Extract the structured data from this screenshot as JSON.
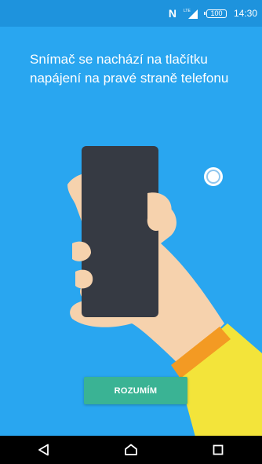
{
  "status_bar": {
    "nfc_label": "N",
    "network_label": "LTE",
    "battery_level": "100",
    "time": "14:30"
  },
  "instruction": {
    "text": "Snímač se nachází na tlačítku napájení na pravé straně telefonu"
  },
  "actions": {
    "understand_label": "ROZUMÍM"
  },
  "nav_bar": {
    "back_icon": "back-triangle-icon",
    "home_icon": "home-icon",
    "recents_icon": "recents-square-icon"
  },
  "colors": {
    "background": "#29a6f0",
    "status_bar": "#1e93dd",
    "button": "#3ab394",
    "phone_body": "#363a43",
    "skin": "#f6d2ad",
    "sleeve": "#f3e43a",
    "watch_band": "#f39a23",
    "nav_bar": "#000000"
  }
}
